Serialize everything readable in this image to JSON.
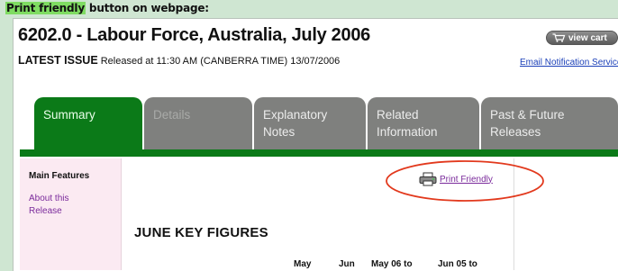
{
  "caption": {
    "highlight": "Print friendly",
    "rest": " button on webpage:"
  },
  "header": {
    "title": "6202.0 - Labour Force, Australia, July 2006",
    "latest_label": "LATEST ISSUE",
    "release_text": " Released at 11:30 AM (CANBERRA TIME) 13/07/2006",
    "view_cart": "view cart",
    "email_link": "Email Notification Service"
  },
  "tabs": [
    {
      "line1": "Summary",
      "line2": ""
    },
    {
      "line1": "Details",
      "line2": ""
    },
    {
      "line1": "Explanatory",
      "line2": "Notes"
    },
    {
      "line1": "Related",
      "line2": "Information"
    },
    {
      "line1": "Past & Future",
      "line2": "Releases"
    }
  ],
  "sidebar": {
    "title": "Main Features",
    "link": "About this Release"
  },
  "main": {
    "print_link": "Print Friendly",
    "heading": "JUNE KEY FIGURES",
    "columns": [
      "May",
      "Jun",
      "May 06 to",
      "Jun 05 to"
    ]
  },
  "colors": {
    "tab_active": "#0b7a18",
    "tab_inactive": "#7f807e",
    "highlight_oval": "#e2391d",
    "caption_highlight": "#7fdc62",
    "link_purple": "#7a2a9b",
    "link_blue": "#1a3fb8"
  },
  "icons": [
    "cart-icon",
    "printer-icon"
  ]
}
